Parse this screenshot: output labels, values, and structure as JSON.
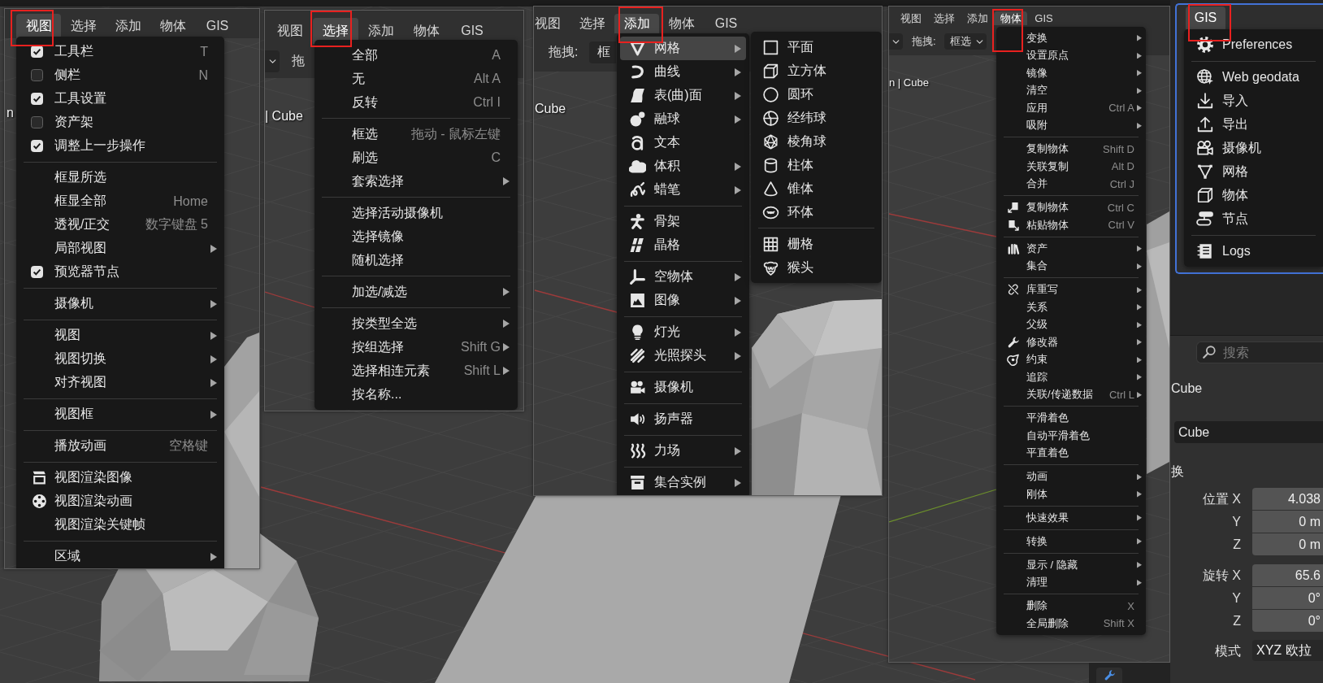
{
  "panels": [
    {
      "menubar": [
        {
          "label": "视图",
          "selected": true
        },
        {
          "label": "选择",
          "selected": false
        },
        {
          "label": "添加",
          "selected": false
        },
        {
          "label": "物体",
          "selected": false
        },
        {
          "label": "GIS",
          "selected": false
        }
      ],
      "viewport_label": "n",
      "menu": {
        "groups": [
          {
            "items": [
              {
                "kind": "check",
                "label": "工具栏",
                "shortcut": "T",
                "checked": true,
                "submenu": false
              },
              {
                "kind": "check",
                "label": "侧栏",
                "shortcut": "N",
                "checked": false,
                "submenu": false
              },
              {
                "kind": "check",
                "label": "工具设置",
                "checked": true,
                "submenu": false
              },
              {
                "kind": "check",
                "label": "资产架",
                "checked": false,
                "submenu": false
              },
              {
                "kind": "check",
                "label": "调整上一步操作",
                "checked": true,
                "submenu": false
              }
            ]
          },
          {
            "items": [
              {
                "kind": "plain",
                "label": "框显所选",
                "submenu": false
              },
              {
                "kind": "plain",
                "label": "框显全部",
                "shortcut": "Home",
                "submenu": false
              },
              {
                "kind": "plain",
                "label": "透视/正交",
                "shortcut": "数字键盘 5",
                "submenu": false
              },
              {
                "kind": "plain",
                "label": "局部视图",
                "submenu": true
              },
              {
                "kind": "check",
                "label": "预览器节点",
                "checked": true,
                "submenu": false
              }
            ]
          },
          {
            "items": [
              {
                "kind": "plain",
                "label": "摄像机",
                "submenu": true
              }
            ]
          },
          {
            "items": [
              {
                "kind": "plain",
                "label": "视图",
                "submenu": true
              },
              {
                "kind": "plain",
                "label": "视图切换",
                "submenu": true
              },
              {
                "kind": "plain",
                "label": "对齐视图",
                "submenu": true
              }
            ]
          },
          {
            "items": [
              {
                "kind": "plain",
                "label": "视图框",
                "submenu": true
              }
            ]
          },
          {
            "items": [
              {
                "kind": "plain",
                "label": "播放动画",
                "shortcut": "空格键",
                "submenu": false
              }
            ]
          },
          {
            "items": [
              {
                "kind": "icon",
                "label": "视图渲染图像",
                "submenu": false
              },
              {
                "kind": "icon",
                "label": "视图渲染动画",
                "submenu": false
              },
              {
                "kind": "plain",
                "label": "视图渲染关键帧",
                "submenu": false
              }
            ]
          },
          {
            "items": [
              {
                "kind": "plain",
                "label": "区域",
                "submenu": true
              }
            ]
          }
        ]
      }
    },
    {
      "menubar": [
        {
          "label": "视图",
          "selected": false
        },
        {
          "label": "选择",
          "selected": true
        },
        {
          "label": "添加",
          "selected": false
        },
        {
          "label": "物体",
          "selected": false
        },
        {
          "label": "GIS",
          "selected": false
        }
      ],
      "toolbar": {
        "drag_label": "拖"
      },
      "viewport_label": "| Cube",
      "menu": {
        "groups": [
          {
            "items": [
              {
                "kind": "plain",
                "label": "全部",
                "shortcut": "A",
                "submenu": false
              },
              {
                "kind": "plain",
                "label": "无",
                "shortcut": "Alt A",
                "submenu": false
              },
              {
                "kind": "plain",
                "label": "反转",
                "shortcut": "Ctrl I",
                "submenu": false
              }
            ]
          },
          {
            "items": [
              {
                "kind": "plain",
                "label": "框选",
                "shortcut": "拖动 - 鼠标左键",
                "submenu": false
              },
              {
                "kind": "plain",
                "label": "刷选",
                "shortcut": "C",
                "submenu": false
              },
              {
                "kind": "plain",
                "label": "套索选择",
                "submenu": true
              }
            ]
          },
          {
            "items": [
              {
                "kind": "plain",
                "label": "选择活动摄像机",
                "submenu": false
              },
              {
                "kind": "plain",
                "label": "选择镜像",
                "submenu": false
              },
              {
                "kind": "plain",
                "label": "随机选择",
                "submenu": false
              }
            ]
          },
          {
            "items": [
              {
                "kind": "plain",
                "label": "加选/减选",
                "submenu": true
              }
            ]
          },
          {
            "items": [
              {
                "kind": "plain",
                "label": "按类型全选",
                "submenu": true
              },
              {
                "kind": "plain",
                "label": "按组选择",
                "shortcut": "Shift G",
                "submenu": true
              },
              {
                "kind": "plain",
                "label": "选择相连元素",
                "shortcut": "Shift L",
                "submenu": true
              },
              {
                "kind": "plain",
                "label": "按名称...",
                "submenu": false
              }
            ]
          }
        ]
      }
    },
    {
      "menubar": [
        {
          "label": "视图",
          "selected": false
        },
        {
          "label": "选择",
          "selected": false
        },
        {
          "label": "添加",
          "selected": true
        },
        {
          "label": "物体",
          "selected": false
        },
        {
          "label": "GIS",
          "selected": false
        }
      ],
      "toolbar": {
        "drag_label": "拖拽:",
        "select_mode": "框"
      },
      "viewport_label": "Cube",
      "menu": {
        "groups": [
          {
            "items": [
              {
                "kind": "icon",
                "label": "网格",
                "submenu": true,
                "selected": true
              },
              {
                "kind": "icon",
                "label": "曲线",
                "submenu": true,
                "selected": false
              },
              {
                "kind": "icon",
                "label": "表(曲)面",
                "submenu": true,
                "selected": false
              },
              {
                "kind": "icon",
                "label": "融球",
                "submenu": true,
                "selected": false
              },
              {
                "kind": "icon",
                "label": "文本",
                "submenu": false,
                "selected": false
              },
              {
                "kind": "icon",
                "label": "体积",
                "submenu": true,
                "selected": false
              },
              {
                "kind": "icon",
                "label": "蜡笔",
                "submenu": true,
                "selected": false
              }
            ]
          },
          {
            "items": [
              {
                "kind": "icon",
                "label": "骨架",
                "submenu": false,
                "selected": false
              },
              {
                "kind": "icon",
                "label": "晶格",
                "submenu": false,
                "selected": false
              }
            ]
          },
          {
            "items": [
              {
                "kind": "icon",
                "label": "空物体",
                "submenu": true,
                "selected": false
              },
              {
                "kind": "icon",
                "label": "图像",
                "submenu": true,
                "selected": false
              }
            ]
          },
          {
            "items": [
              {
                "kind": "icon",
                "label": "灯光",
                "submenu": true,
                "selected": false
              },
              {
                "kind": "icon",
                "label": "光照探头",
                "submenu": true,
                "selected": false
              }
            ]
          },
          {
            "items": [
              {
                "kind": "icon",
                "label": "摄像机",
                "submenu": false,
                "selected": false
              }
            ]
          },
          {
            "items": [
              {
                "kind": "icon",
                "label": "扬声器",
                "submenu": false,
                "selected": false
              }
            ]
          },
          {
            "items": [
              {
                "kind": "icon",
                "label": "力场",
                "submenu": true,
                "selected": false
              }
            ]
          },
          {
            "items": [
              {
                "kind": "icon",
                "label": "集合实例",
                "submenu": true,
                "selected": false
              }
            ]
          }
        ]
      },
      "flyout": {
        "groups": [
          {
            "items": [
              {
                "kind": "icon",
                "label": "平面"
              },
              {
                "kind": "icon",
                "label": "立方体"
              },
              {
                "kind": "icon",
                "label": "圆环"
              },
              {
                "kind": "icon",
                "label": "经纬球"
              },
              {
                "kind": "icon",
                "label": "棱角球"
              },
              {
                "kind": "icon",
                "label": "柱体"
              },
              {
                "kind": "icon",
                "label": "锥体"
              },
              {
                "kind": "icon",
                "label": "环体"
              }
            ]
          },
          {
            "items": [
              {
                "kind": "icon",
                "label": "栅格"
              },
              {
                "kind": "icon",
                "label": "猴头"
              }
            ]
          }
        ]
      }
    },
    {
      "menubar": [
        {
          "label": "视图",
          "selected": false
        },
        {
          "label": "选择",
          "selected": false
        },
        {
          "label": "添加",
          "selected": false
        },
        {
          "label": "物体",
          "selected": true
        },
        {
          "label": "GIS",
          "selected": false
        }
      ],
      "toolbar": {
        "drag_label": "拖拽:",
        "select_mode": "框选"
      },
      "viewport_label": "n | Cube",
      "menu": {
        "groups": [
          {
            "items": [
              {
                "kind": "plain",
                "label": "变换",
                "submenu": true
              },
              {
                "kind": "plain",
                "label": "设置原点",
                "submenu": true
              },
              {
                "kind": "plain",
                "label": "镜像",
                "submenu": true
              },
              {
                "kind": "plain",
                "label": "清空",
                "submenu": true
              },
              {
                "kind": "plain",
                "label": "应用",
                "shortcut": "Ctrl A",
                "submenu": true
              },
              {
                "kind": "plain",
                "label": "吸附",
                "submenu": true
              }
            ]
          },
          {
            "items": [
              {
                "kind": "plain",
                "label": "复制物体",
                "shortcut": "Shift D",
                "submenu": false
              },
              {
                "kind": "plain",
                "label": "关联复制",
                "shortcut": "Alt D",
                "submenu": false
              },
              {
                "kind": "plain",
                "label": "合并",
                "shortcut": "Ctrl J",
                "submenu": false
              }
            ]
          },
          {
            "items": [
              {
                "kind": "icon",
                "label": "复制物体",
                "shortcut": "Ctrl C",
                "submenu": false
              },
              {
                "kind": "icon",
                "label": "粘贴物体",
                "shortcut": "Ctrl V",
                "submenu": false
              }
            ]
          },
          {
            "items": [
              {
                "kind": "icon",
                "label": "资产",
                "submenu": true
              },
              {
                "kind": "plain",
                "label": "集合",
                "submenu": true
              }
            ]
          },
          {
            "items": [
              {
                "kind": "icon",
                "label": "库重写",
                "submenu": true
              },
              {
                "kind": "plain",
                "label": "关系",
                "submenu": true
              },
              {
                "kind": "plain",
                "label": "父级",
                "submenu": true
              },
              {
                "kind": "icon",
                "label": "修改器",
                "submenu": true
              },
              {
                "kind": "icon",
                "label": "约束",
                "submenu": true
              },
              {
                "kind": "plain",
                "label": "追踪",
                "submenu": true
              },
              {
                "kind": "plain",
                "label": "关联/传递数据",
                "shortcut": "Ctrl L",
                "submenu": true
              }
            ]
          },
          {
            "items": [
              {
                "kind": "plain",
                "label": "平滑着色",
                "submenu": false
              },
              {
                "kind": "plain",
                "label": "自动平滑着色",
                "submenu": false
              },
              {
                "kind": "plain",
                "label": "平直着色",
                "submenu": false
              }
            ]
          },
          {
            "items": [
              {
                "kind": "plain",
                "label": "动画",
                "submenu": true
              },
              {
                "kind": "plain",
                "label": "刚体",
                "submenu": true
              }
            ]
          },
          {
            "items": [
              {
                "kind": "plain",
                "label": "快速效果",
                "submenu": true
              }
            ]
          },
          {
            "items": [
              {
                "kind": "plain",
                "label": "转换",
                "submenu": true
              }
            ]
          },
          {
            "items": [
              {
                "kind": "plain",
                "label": "显示 / 隐藏",
                "submenu": true
              },
              {
                "kind": "plain",
                "label": "清理",
                "submenu": true
              }
            ]
          },
          {
            "items": [
              {
                "kind": "plain",
                "label": "删除",
                "shortcut": "X",
                "submenu": false
              },
              {
                "kind": "plain",
                "label": "全局删除",
                "shortcut": "Shift X",
                "submenu": false
              }
            ]
          }
        ]
      }
    }
  ],
  "gis": {
    "tab": {
      "label": "GIS",
      "selected": true
    },
    "menu": {
      "groups": [
        {
          "items": [
            {
              "kind": "icon",
              "label": "Preferences"
            }
          ]
        },
        {
          "items": [
            {
              "kind": "icon",
              "label": "Web geodata"
            },
            {
              "kind": "icon",
              "label": "导入"
            },
            {
              "kind": "icon",
              "label": "导出"
            },
            {
              "kind": "icon",
              "label": "摄像机"
            },
            {
              "kind": "icon",
              "label": "网格"
            },
            {
              "kind": "icon",
              "label": "物体"
            },
            {
              "kind": "icon",
              "label": "节点"
            }
          ]
        },
        {
          "items": [
            {
              "kind": "icon",
              "label": "Logs"
            }
          ]
        }
      ]
    }
  },
  "properties": {
    "search": {
      "placeholder": "搜索"
    },
    "object_label": "Cube",
    "name_field": "Cube",
    "section": "换",
    "transform": [
      {
        "rows": [
          {
            "label": "位置 X",
            "value": "4.038"
          },
          {
            "label": "Y",
            "value": "0 m"
          },
          {
            "label": "Z",
            "value": "0 m"
          }
        ]
      },
      {
        "rows": [
          {
            "label": "旋转 X",
            "value": "65.6"
          },
          {
            "label": "Y",
            "value": "0°"
          },
          {
            "label": "Z",
            "value": "0°"
          }
        ]
      }
    ],
    "mode": {
      "label": "模式",
      "value": "XYZ 欧拉"
    }
  }
}
